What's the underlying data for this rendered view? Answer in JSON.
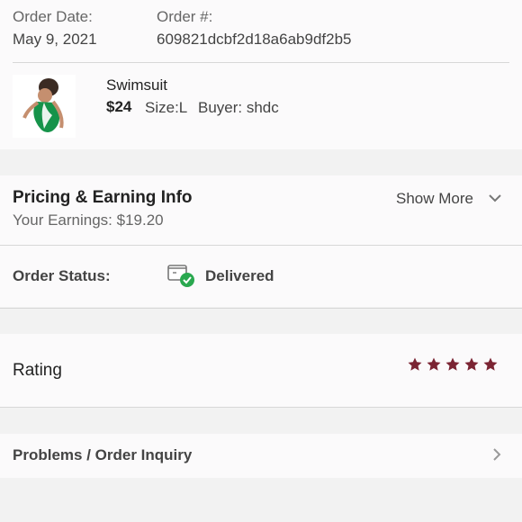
{
  "order": {
    "date_label": "Order Date:",
    "date_value": "May 9, 2021",
    "number_label": "Order #:",
    "number_value": "609821dcbf2d18a6ab9df2b5"
  },
  "item": {
    "name": "Swimsuit",
    "price": "$24",
    "size": "Size:L",
    "buyer": "Buyer: shdc",
    "thumbnail_icon": "swimsuit-thumbnail"
  },
  "pricing": {
    "title": "Pricing & Earning Info",
    "earnings": "Your Earnings: $19.20",
    "show_more": "Show More"
  },
  "status": {
    "label": "Order Status:",
    "value": "Delivered",
    "icon": "delivered-package-icon"
  },
  "rating": {
    "label": "Rating",
    "stars_filled": 5,
    "stars_total": 5
  },
  "inquiry": {
    "label": "Problems / Order Inquiry"
  },
  "colors": {
    "star": "#7b2433",
    "check": "#2aa84f",
    "divider": "#d7d7d7",
    "background": "#f2f2f2",
    "panel": "#fbfafb"
  }
}
